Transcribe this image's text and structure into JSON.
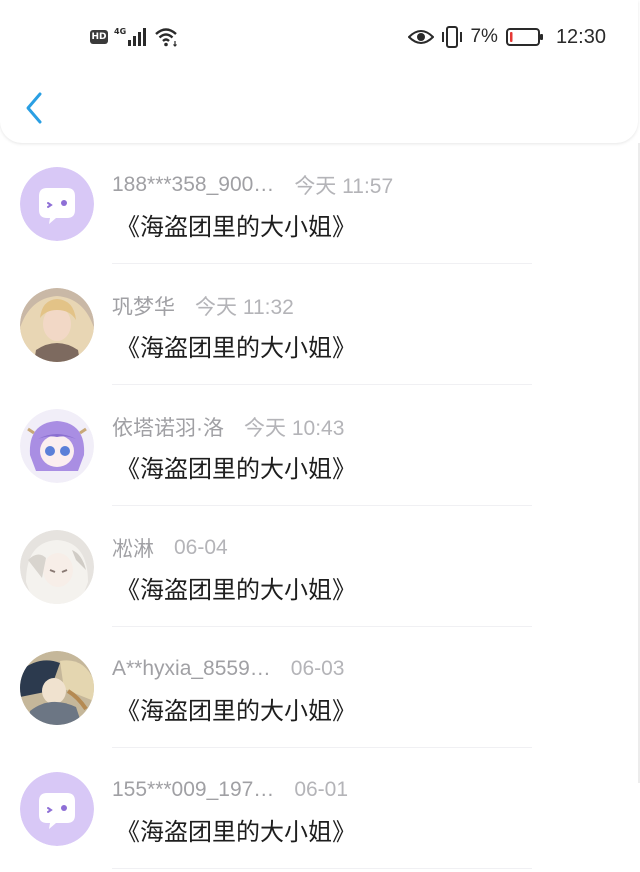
{
  "status_bar": {
    "hd_label": "HD",
    "network_label": "4G",
    "battery_percent": "7%",
    "time": "12:30",
    "icons": [
      "hd-badge-icon",
      "signal-icon",
      "wifi-icon",
      "eye-icon",
      "vibrate-icon",
      "battery-icon"
    ],
    "battery_level": 0.07,
    "battery_color": "#e53935"
  },
  "header": {
    "back_icon": "chevron-left-icon",
    "accent_color": "#2a9fe3"
  },
  "comments": [
    {
      "user": "188***358_900…",
      "time": "今天 11:57",
      "message": "《海盗团里的大小姐》",
      "avatar": "default-chat-avatar"
    },
    {
      "user": "巩梦华",
      "time": "今天 11:32",
      "message": "《海盗团里的大小姐》",
      "avatar": "photo-avatar-blonde"
    },
    {
      "user": "依塔诺羽·洛",
      "time": "今天 10:43",
      "message": "《海盗团里的大小姐》",
      "avatar": "anime-avatar-purple-hair"
    },
    {
      "user": "凇淋",
      "time": "06-04",
      "message": "《海盗团里的大小姐》",
      "avatar": "anime-avatar-white-hair"
    },
    {
      "user": "A**hyxia_8559…",
      "time": "06-03",
      "message": "《海盗团里的大小姐》",
      "avatar": "illustration-avatar"
    },
    {
      "user": "155***009_197…",
      "time": "06-01",
      "message": "《海盗团里的大小姐》",
      "avatar": "default-chat-avatar"
    }
  ]
}
